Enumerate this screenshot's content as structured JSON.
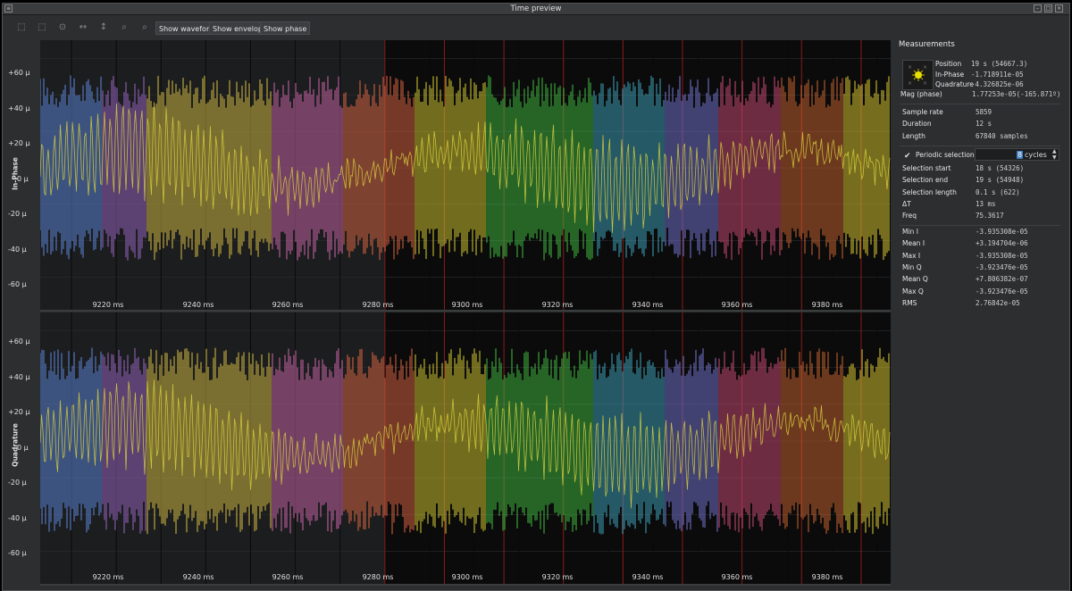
{
  "window": {
    "title": "Time preview"
  },
  "toolbar": {
    "tools": [
      {
        "icon": "zoom-in-icon",
        "glyph": "⬚"
      },
      {
        "icon": "zoom-out-icon",
        "glyph": "⬚"
      },
      {
        "icon": "zoom-fit-icon",
        "glyph": "⊙"
      },
      {
        "icon": "horizontal-fit-icon",
        "glyph": "↔"
      },
      {
        "icon": "vertical-fit-icon",
        "glyph": "↕"
      },
      {
        "icon": "magnify-icon",
        "glyph": "⌕"
      },
      {
        "icon": "magnify-minus-icon",
        "glyph": "⌕"
      }
    ],
    "show_waveform": "Show waveform",
    "show_envelope": "Show envelope",
    "show_phase": "Show phase"
  },
  "plots": {
    "inphase_label": "In-Phase",
    "quadrature_label": "Quadrature",
    "y_ticks": [
      "+60 µ",
      "+40 µ",
      "+20 µ",
      "0 µ",
      "-20 µ",
      "-40 µ",
      "-60 µ"
    ],
    "x_ticks": [
      "9220 ms",
      "9240 ms",
      "9260 ms",
      "9280 ms",
      "9300 ms",
      "9320 ms",
      "9340 ms",
      "9360 ms",
      "9380 ms"
    ]
  },
  "chart_data": [
    {
      "type": "area",
      "title": "",
      "ylabel": "In-Phase",
      "xlabel": "",
      "x_range_ms": [
        9203,
        9393
      ],
      "ylim": [
        -70,
        70
      ],
      "y_unit": "µ",
      "envelope_approx": {
        "upper": 40,
        "lower": -40
      },
      "selection_ms": [
        9280,
        9393
      ]
    },
    {
      "type": "area",
      "title": "",
      "ylabel": "Quadrature",
      "xlabel": "",
      "x_range_ms": [
        9203,
        9393
      ],
      "ylim": [
        -70,
        70
      ],
      "y_unit": "µ",
      "envelope_approx": {
        "upper": 40,
        "lower": -40
      },
      "selection_ms": [
        9280,
        9393
      ]
    }
  ],
  "measurements": {
    "header": "Measurements",
    "position_label": "Position",
    "position": "19 s (54667.3)",
    "inphase_label": "In-Phase",
    "inphase": "-1.718911e-05",
    "quad_label": "Quadrature",
    "quad": "-4.326825e-06",
    "mag_label": "Mag (phase)",
    "mag": "1.77253e-05(-165.871º)",
    "rows1": [
      {
        "k": "Sample rate",
        "v": "5859"
      },
      {
        "k": "Duration",
        "v": "12 s"
      },
      {
        "k": "Length",
        "v": "67840 samples"
      }
    ],
    "periodic_label": "Periodic selection",
    "periodic_checked": "✔",
    "cycles_value": "8",
    "cycles_label": "cycles",
    "rows2": [
      {
        "k": "Selection start",
        "v": "18 s (54326)"
      },
      {
        "k": "Selection end",
        "v": "19 s (54948)"
      },
      {
        "k": "Selection length",
        "v": "0.1 s (622)"
      },
      {
        "k": "ΔT",
        "v": "13 ms"
      },
      {
        "k": "Freq",
        "v": "75.3617"
      }
    ],
    "rows3": [
      {
        "k": "Min I",
        "v": "-3.935308e-05"
      },
      {
        "k": "Mean I",
        "v": "+3.194704e-06"
      },
      {
        "k": "Max I",
        "v": "-3.935308e-05"
      },
      {
        "k": "Min Q",
        "v": "-3.923476e-05"
      },
      {
        "k": "Mean Q",
        "v": "+7.806382e-07"
      },
      {
        "k": "Max Q",
        "v": "-3.923476e-05"
      },
      {
        "k": "RMS",
        "v": "2.76842e-05"
      }
    ]
  }
}
